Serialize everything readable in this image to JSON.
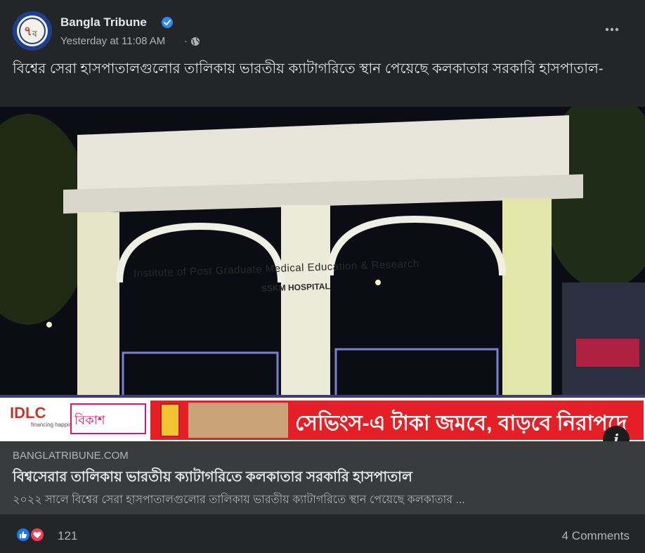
{
  "header": {
    "page_name": "Bangla Tribune",
    "timestamp": "Yesterday at 11:08 AM",
    "separator": "·",
    "verified_icon": "verified-badge-icon",
    "privacy_icon": "globe-icon",
    "more_icon": "more-options-icon"
  },
  "post": {
    "text": "বিশ্বের সেরা হাসপাতালগুলোর তালিকায় ভারতীয় ক্যাটাগরিতে স্থান পেয়েছে কলকাতার সরকারি হাসপাতাল-"
  },
  "image": {
    "building_line1": "Institute of Post Graduate Medical Education & Research",
    "building_line2": "SSKM HOSPITAL",
    "ad": {
      "idlc": "IDLC",
      "idlc_tagline": "financing happiness",
      "bkash": "বিকাশ",
      "slogan": "সেভিংস-এ টাকা জমবে, বাড়বে নিরাপদে"
    },
    "info_button": "i"
  },
  "link_preview": {
    "domain": "BANGLATRIBUNE.COM",
    "title": "বিশ্বসেরার তালিকায় ভারতীয় ক্যাটাগরিতে কলকাতার সরকারি হাসপাতাল",
    "description": "২০২২ সালে বিশ্বের সেরা হাসপাতালগুলোর তালিকায় ভারতীয় ক্যাটাগরিতে স্থান পেয়েছে কলকাতার ..."
  },
  "footer": {
    "reactions_count": "121",
    "comments": "4 Comments"
  },
  "colors": {
    "background": "#242526",
    "link_box": "#3a3b3c",
    "primary_text": "#e4e6eb",
    "secondary_text": "#b0b3b8",
    "like_blue": "#1877f2",
    "love_red": "#f33e58",
    "ad_red": "#e61e25"
  }
}
